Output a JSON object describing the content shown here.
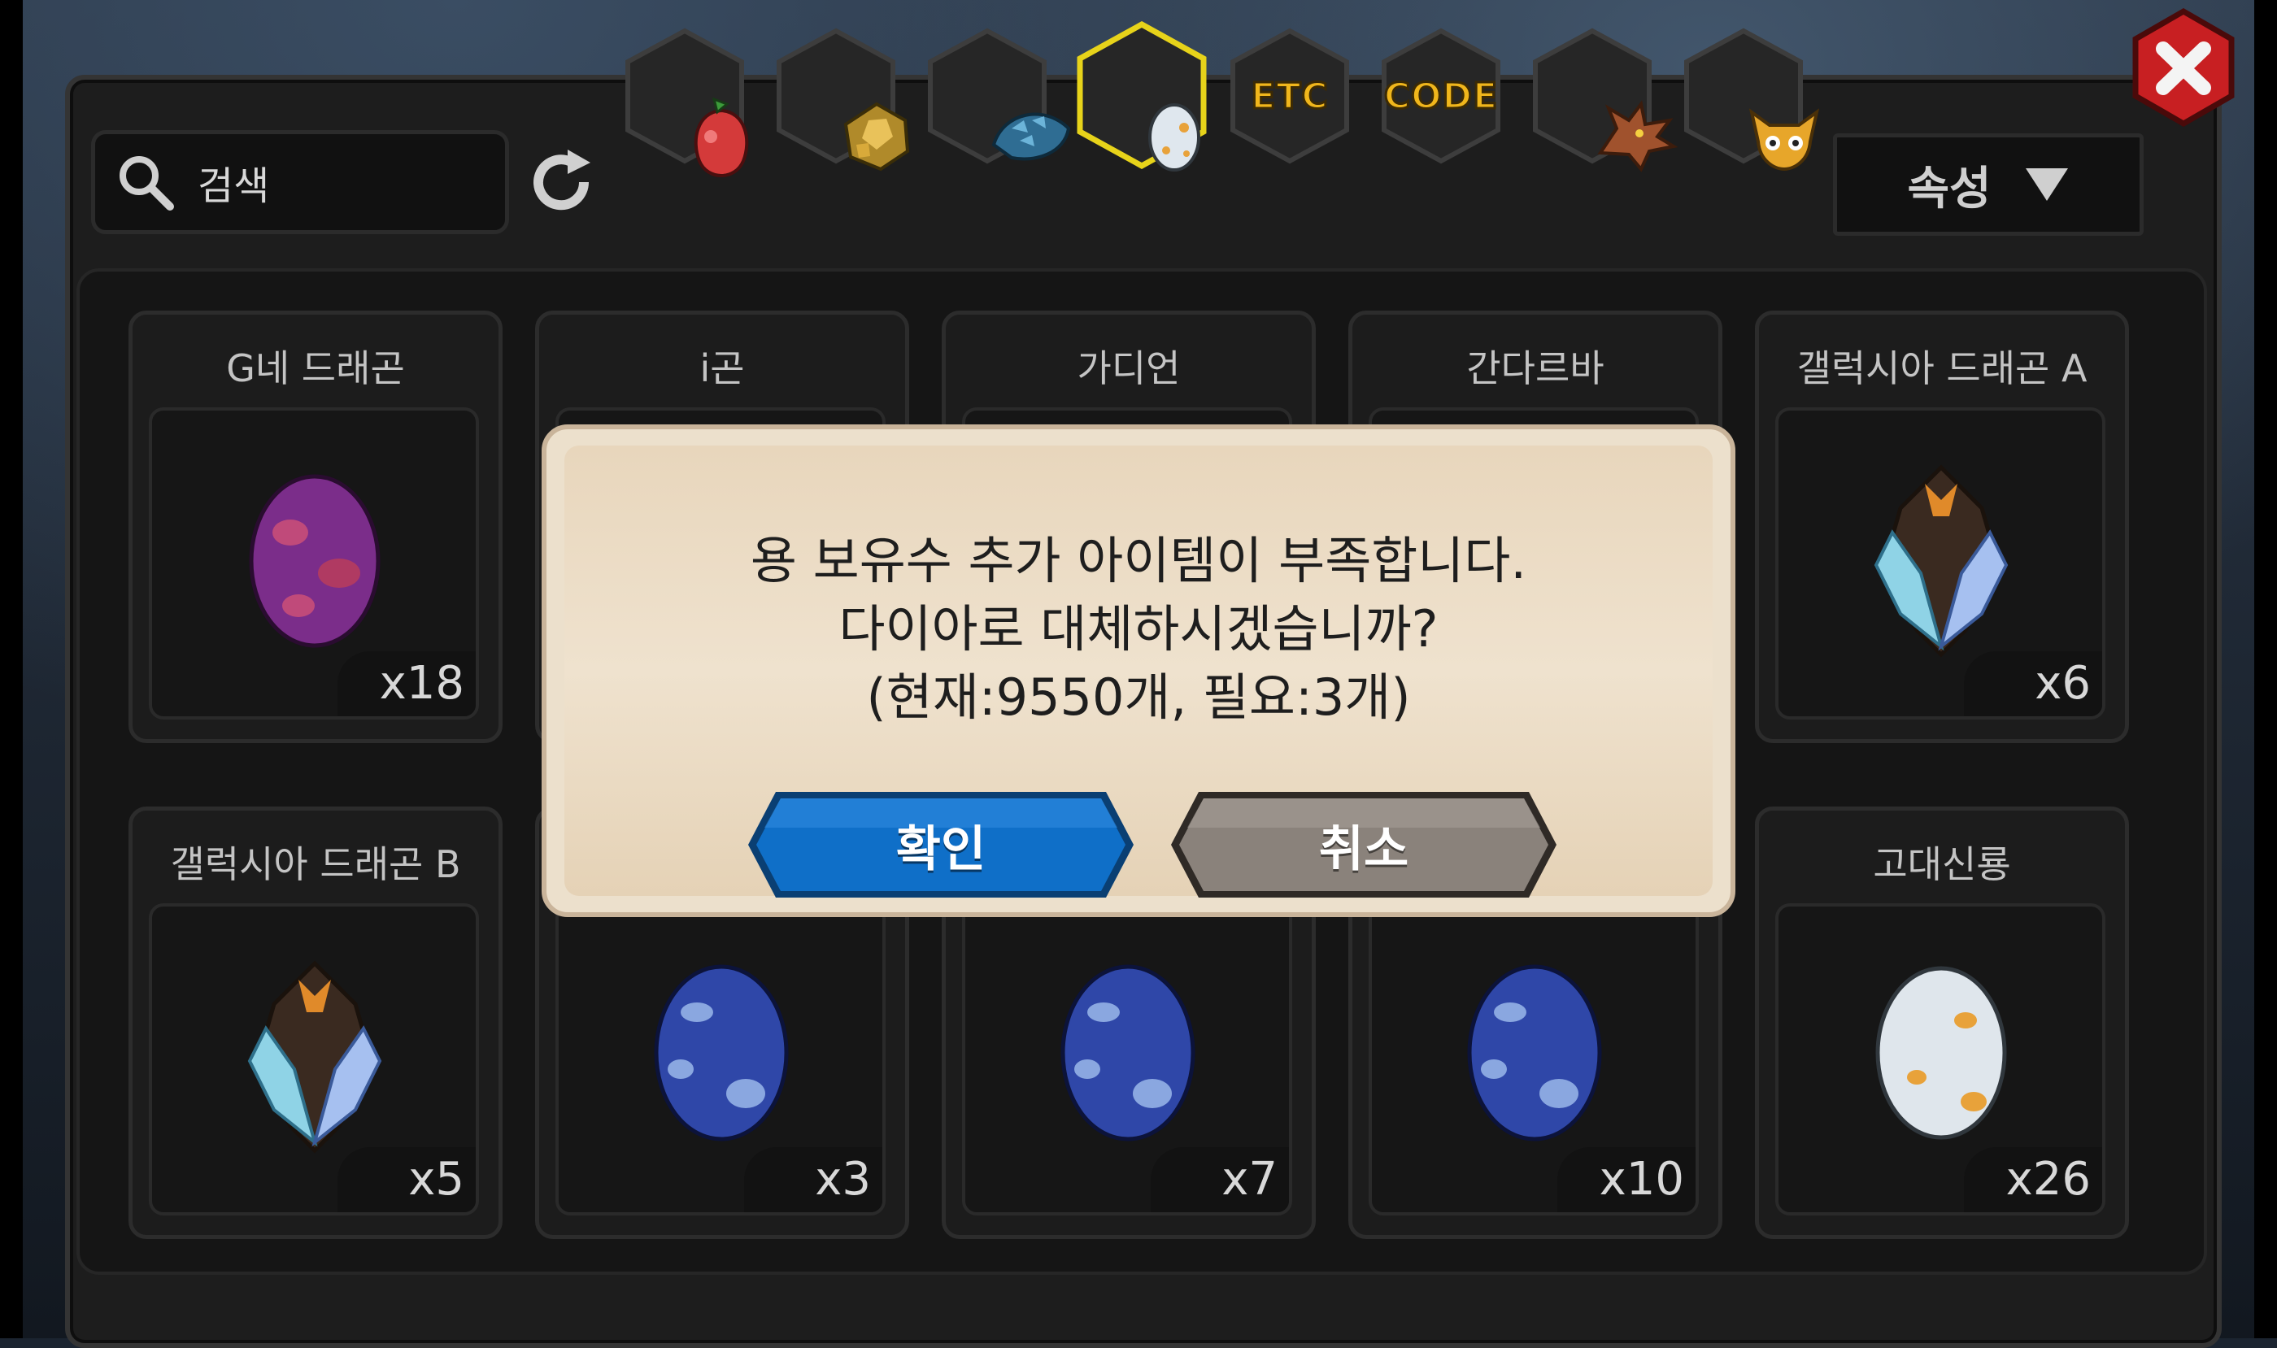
{
  "tabs": [
    {
      "name": "fruit-tab",
      "icon": "fruit-icon"
    },
    {
      "name": "ore-tab",
      "icon": "gold-ore-icon"
    },
    {
      "name": "scale-tab",
      "icon": "dragon-scale-icon"
    },
    {
      "name": "egg-tab",
      "icon": "egg-icon",
      "active": true
    },
    {
      "name": "etc-tab",
      "label": "ETC"
    },
    {
      "name": "code-tab",
      "label": "CODE"
    },
    {
      "name": "dragon-tab",
      "icon": "dragon-head-icon"
    },
    {
      "name": "pet-tab",
      "icon": "goblin-face-icon"
    }
  ],
  "search": {
    "placeholder": "검색"
  },
  "filter": {
    "label": "속성"
  },
  "cards": [
    {
      "title": "G네 드래곤",
      "count": "x18",
      "item": "purple-egg"
    },
    {
      "title": "i곤",
      "count": "",
      "item": "hidden"
    },
    {
      "title": "가디언",
      "count": "",
      "item": "hidden"
    },
    {
      "title": "간다르바",
      "count": "",
      "item": "hidden"
    },
    {
      "title": "갤럭시아 드래곤 A",
      "count": "x6",
      "item": "crystal-egg"
    },
    {
      "title": "갤럭시아 드래곤 B",
      "count": "x5",
      "item": "crystal-egg"
    },
    {
      "title": "",
      "count": "x3",
      "item": "blue-egg"
    },
    {
      "title": "",
      "count": "x7",
      "item": "blue-egg"
    },
    {
      "title": "",
      "count": "x10",
      "item": "blue-egg"
    },
    {
      "title": "고대신룡",
      "count": "x26",
      "item": "white-egg"
    }
  ],
  "dialog": {
    "line1": "용 보유수 추가 아이템이 부족합니다.",
    "line2": "다이아로 대체하시겠습니까?",
    "line3": "(현재:9550개, 필요:3개)",
    "confirm": "확인",
    "cancel": "취소"
  },
  "colors": {
    "confirm": "#0f6fc8",
    "cancel": "#8a827b",
    "active_tab_border": "#e7d31a",
    "tab_text": "#f0b61c",
    "close_button": "#c81f22"
  }
}
